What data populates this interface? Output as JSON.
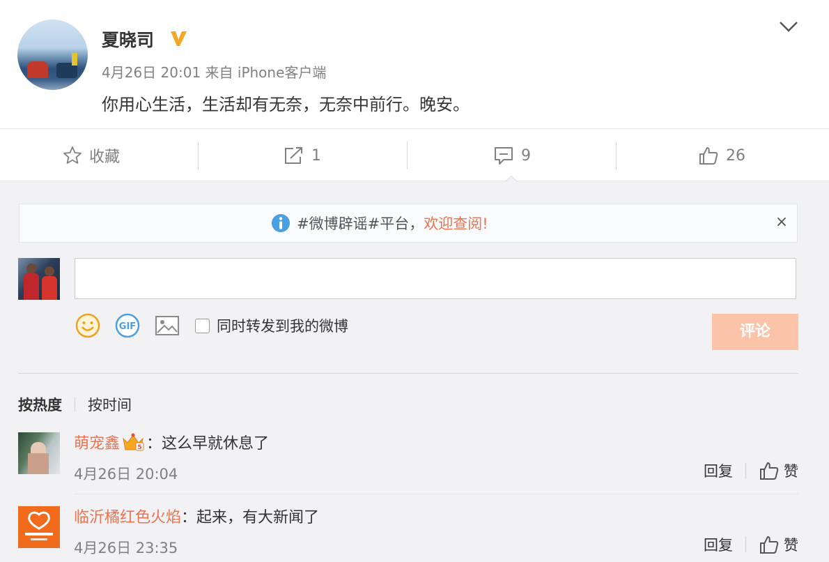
{
  "post": {
    "username": "夏晓司",
    "meta": "4月26日 20:01 来自 iPhone客户端",
    "text": "你用心生活，生活却有无奈，无奈中前行。晚安。"
  },
  "actions": {
    "favorite": "收藏",
    "repost_count": "1",
    "comment_count": "9",
    "like_count": "26"
  },
  "notice": {
    "text": "#微博辟谣#平台，",
    "link": "欢迎查阅!",
    "close": "×"
  },
  "composer": {
    "repost_label": "同时转发到我的微博",
    "submit_label": "评论"
  },
  "sort": {
    "hot": "按热度",
    "time": "按时间"
  },
  "comments": [
    {
      "name": "萌宠鑫",
      "content": "：这么早就休息了",
      "time": "4月26日 20:04",
      "reply": "回复",
      "like": "赞"
    },
    {
      "name": "临沂橘红色火焰",
      "content": "：起来，有大新闻了",
      "time": "4月26日 23:35",
      "reply": "回复",
      "like": "赞"
    }
  ],
  "colors": {
    "accent": "#eb7350",
    "vip_gold": "#f5a623",
    "submit_disabled": "#fbc3a8",
    "info_blue": "#4a9fe0"
  }
}
